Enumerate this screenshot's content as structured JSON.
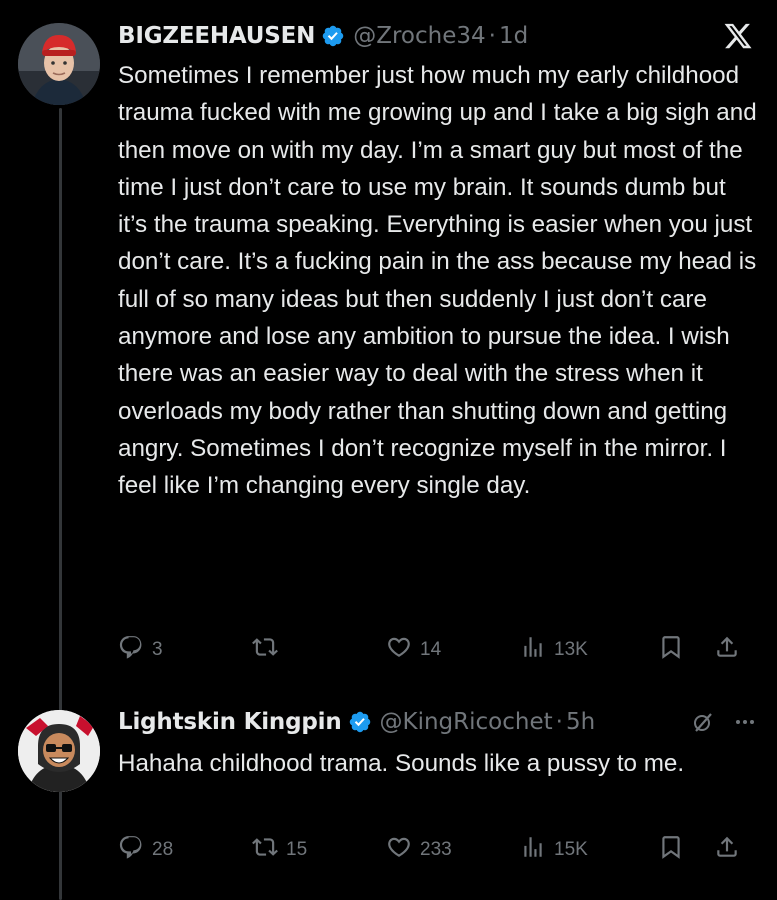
{
  "tweets": [
    {
      "display_name": "BIGZEEHAUSEN",
      "handle": "@Zroche34",
      "separator": "·",
      "time": "1d",
      "text": "Sometimes I remember just how much my early childhood trauma fucked with me growing up and I take a big sigh and then move on with my day. I’m a smart guy but most of the time I just don’t care to use my brain. It sounds dumb but it’s the trauma speaking. Everything is easier when you just don’t care. It’s a fucking pain in the ass because my head is full of so many ideas but then suddenly I just don’t care anymore and lose any ambition to pursue the idea. I wish there was an easier way to deal with the stress when it overloads my body rather than shutting down and getting angry. Sometimes I don’t recognize myself in the mirror. I feel like I’m changing every single day.",
      "replies": "3",
      "reposts": "",
      "likes": "14",
      "views": "13K"
    },
    {
      "display_name": "Lightskin Kingpin",
      "handle": "@KingRicochet",
      "separator": "·",
      "time": "5h",
      "text": "Hahaha childhood trama. Sounds like a pussy to me.",
      "replies": "28",
      "reposts": "15",
      "likes": "233",
      "views": "15K"
    }
  ],
  "icons": {
    "brand": "x-logo-icon",
    "verified": "verified-badge-icon",
    "reply": "reply-icon",
    "repost": "repost-icon",
    "like": "heart-icon",
    "views": "views-icon",
    "bookmark": "bookmark-icon",
    "share": "share-icon",
    "grok": "grok-icon",
    "more": "more-icon"
  },
  "colors": {
    "background": "#000000",
    "text": "#e7e9ea",
    "muted": "#71767b",
    "verified": "#1d9bf0",
    "thread_line": "#333639"
  }
}
